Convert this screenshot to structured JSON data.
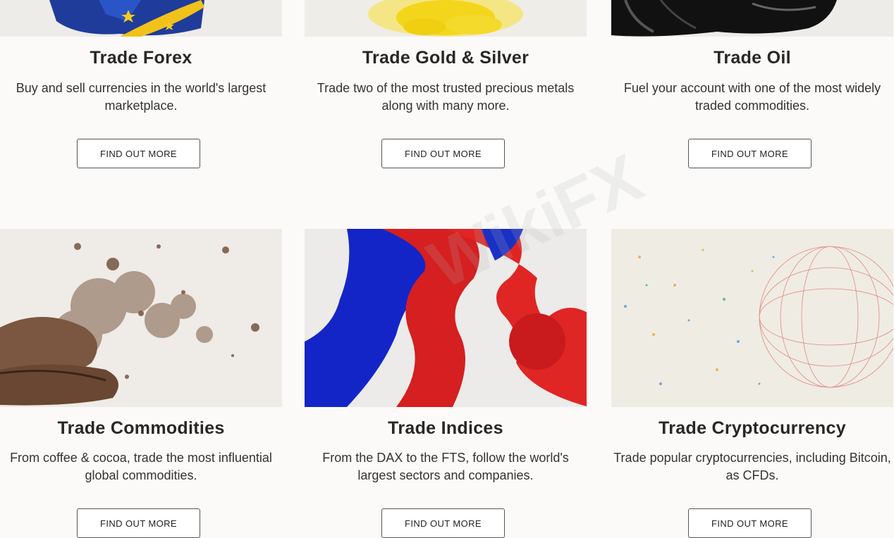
{
  "cards": [
    {
      "title": "Trade Forex",
      "desc": "Buy and sell currencies in the world's largest marketplace.",
      "button": "FIND OUT MORE",
      "image": "eu-flag-splash"
    },
    {
      "title": "Trade Gold & Silver",
      "desc": "Trade two of the most trusted precious metals along with many more.",
      "button": "FIND OUT MORE",
      "image": "gold-dust-splash"
    },
    {
      "title": "Trade Oil",
      "desc": "Fuel your account with one of the most widely traded commodities.",
      "button": "FIND OUT MORE",
      "image": "oil-splash"
    },
    {
      "title": "Trade Commodities",
      "desc": "From coffee & cocoa, trade the most influential global commodities.",
      "button": "FIND OUT MORE",
      "image": "coffee-bean-burst"
    },
    {
      "title": "Trade Indices",
      "desc": "From the DAX to the FTS, follow the world's largest sectors and companies.",
      "button": "FIND OUT MORE",
      "image": "blue-red-ink"
    },
    {
      "title": "Trade Cryptocurrency",
      "desc": "Trade popular cryptocurrencies, including Bitcoin, as CFDs.",
      "button": "FIND OUT MORE",
      "image": "crypto-network-sphere"
    }
  ],
  "watermark": "WikiFX"
}
